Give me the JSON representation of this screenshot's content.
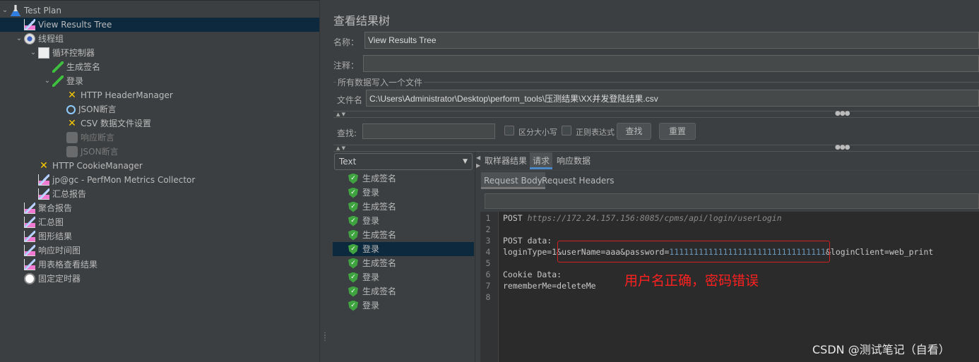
{
  "tree": [
    {
      "label": "Test Plan",
      "icon": "flask-icon",
      "level": 0,
      "expanded": true
    },
    {
      "label": "View Results Tree",
      "icon": "listener-icon",
      "level": 1,
      "selected": true
    },
    {
      "label": "线程组",
      "icon": "gear-icon",
      "level": 1,
      "expanded": true
    },
    {
      "label": "循环控制器",
      "icon": "loop-controller-icon",
      "level": 2,
      "expanded": true
    },
    {
      "label": "生成签名",
      "icon": "sampler-pipette-icon",
      "level": 3
    },
    {
      "label": "登录",
      "icon": "sampler-pipette-icon",
      "level": 3,
      "expanded": true
    },
    {
      "label": "HTTP HeaderManager",
      "icon": "config-tool-icon",
      "level": 4
    },
    {
      "label": "JSON断言",
      "icon": "assertion-search-icon",
      "level": 4
    },
    {
      "label": "CSV 数据文件设置",
      "icon": "config-tool-icon",
      "level": 4
    },
    {
      "label": "响应断言",
      "icon": "disabled-assertion-icon",
      "level": 4,
      "disabled": true
    },
    {
      "label": "JSON断言",
      "icon": "disabled-assertion-icon",
      "level": 4,
      "disabled": true
    },
    {
      "label": "HTTP CookieManager",
      "icon": "config-tool-icon",
      "level": 2
    },
    {
      "label": "jp@gc - PerfMon Metrics Collector",
      "icon": "listener-icon",
      "level": 2
    },
    {
      "label": "汇总报告",
      "icon": "listener-icon",
      "level": 2
    },
    {
      "label": "聚合报告",
      "icon": "listener-icon",
      "level": 1
    },
    {
      "label": "汇总图",
      "icon": "listener-icon",
      "level": 1
    },
    {
      "label": "图形结果",
      "icon": "listener-icon",
      "level": 1
    },
    {
      "label": "响应时间图",
      "icon": "listener-icon",
      "level": 1
    },
    {
      "label": "用表格查看结果",
      "icon": "listener-icon",
      "level": 1
    },
    {
      "label": "固定定时器",
      "icon": "timer-icon",
      "level": 1
    }
  ],
  "panel": {
    "title": "查看结果树",
    "name_label": "名称：",
    "name_value": "View Results Tree",
    "comment_label": "注释：",
    "comment_value": "",
    "file_section": "所有数据写入一个文件",
    "filename_label": "文件名",
    "filename_value": "C:\\Users\\Administrator\\Desktop\\perform_tools\\压测结果\\XX并发登陆结果.csv",
    "search_label": "查找:",
    "search_value": "",
    "case_label": "区分大小写",
    "regex_label": "正则表达式",
    "find_button": "查找",
    "reset_button": "重置"
  },
  "renderer": {
    "selected": "Text"
  },
  "results": [
    {
      "label": "生成签名",
      "status": "success"
    },
    {
      "label": "登录",
      "status": "success"
    },
    {
      "label": "生成签名",
      "status": "success"
    },
    {
      "label": "登录",
      "status": "success"
    },
    {
      "label": "生成签名",
      "status": "success"
    },
    {
      "label": "登录",
      "status": "success",
      "selected": true
    },
    {
      "label": "生成签名",
      "status": "success"
    },
    {
      "label": "登录",
      "status": "success"
    },
    {
      "label": "生成签名",
      "status": "success"
    },
    {
      "label": "登录",
      "status": "success"
    }
  ],
  "tabs": [
    "取样器结果",
    "请求",
    "响应数据"
  ],
  "active_tab": "请求",
  "subtabs": [
    "Request Body",
    "Request Headers"
  ],
  "active_subtab": "Request Body",
  "code": {
    "l1_method": "POST ",
    "l1_url": "https://172.24.157.156:8085/cpms/api/login/userLogin",
    "l3": "POST data:",
    "l4_a": "loginType=1&userName=aaa&password=",
    "l4_num": "11111111111111111111111111111111",
    "l4_b": "&loginClient=web_print",
    "l6": "Cookie Data:",
    "l7": "rememberMe=deleteMe",
    "line_numbers": [
      "1",
      "2",
      "3",
      "4",
      "5",
      "6",
      "7",
      "8"
    ]
  },
  "annotation": {
    "text": "用户名正确，密码错误",
    "color": "#ff2020"
  },
  "watermark": "CSDN @测试笔记（自看）"
}
